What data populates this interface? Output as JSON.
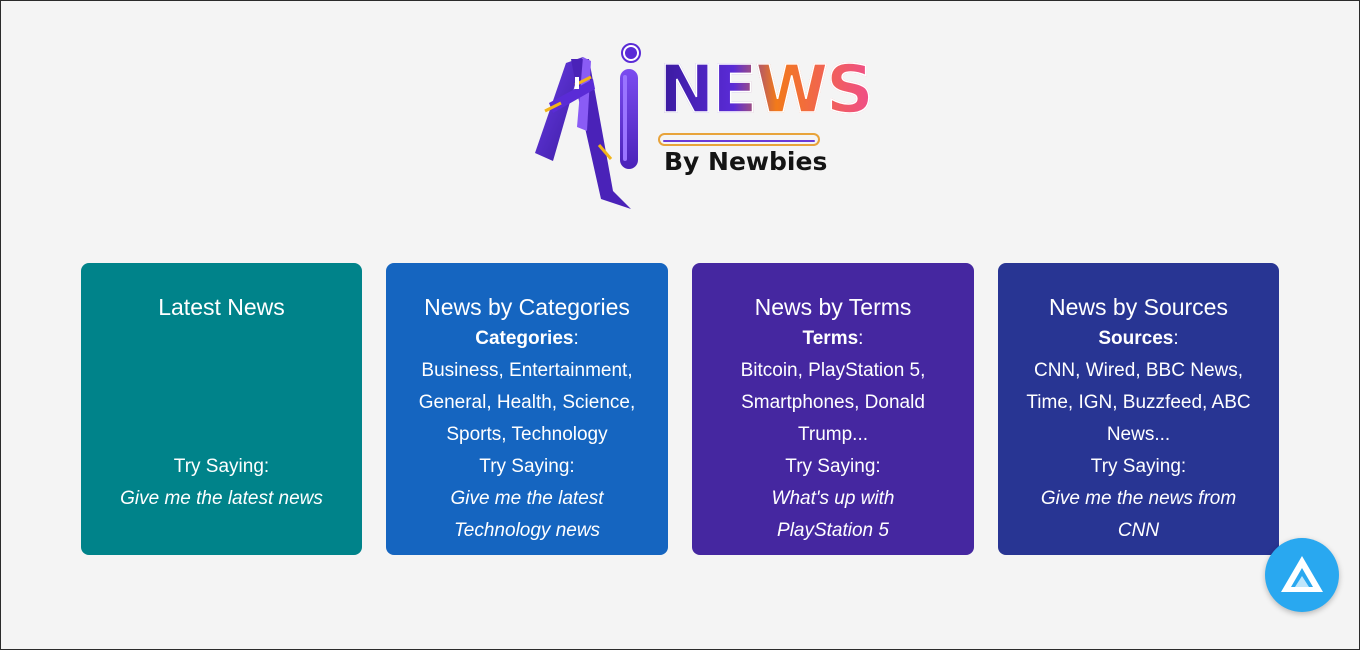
{
  "logo": {
    "word": "NEWS",
    "byline": "By Newbies"
  },
  "cards": [
    {
      "title": "Latest News",
      "try_label": "Try Saying:",
      "example": "Give me the latest news",
      "color": "#00838a"
    },
    {
      "title": "News by Categories",
      "list_label": "Categories",
      "colon": ":",
      "list_text": "Business, Entertainment, General, Health, Science, Sports, Technology",
      "try_label": "Try Saying:",
      "example": "Give me the latest Technology news",
      "color": "#1565c0"
    },
    {
      "title": "News by Terms",
      "list_label": "Terms",
      "colon": ":",
      "list_text": "Bitcoin, PlayStation 5, Smartphones, Donald Trump...",
      "try_label": "Try Saying:",
      "example": "What's up with PlayStation 5",
      "color": "#4527a0"
    },
    {
      "title": "News by Sources",
      "list_label": "Sources",
      "colon": ":",
      "list_text": "CNN, Wired, BBC News, Time, IGN, Buzzfeed, ABC News...",
      "try_label": "Try Saying:",
      "example": "Give me the news from CNN",
      "color": "#283593"
    }
  ],
  "assistant_button": {
    "icon": "alan-ai-icon",
    "color": "#29a8f0"
  }
}
